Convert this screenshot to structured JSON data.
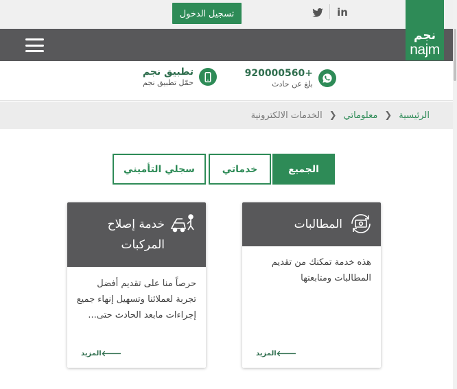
{
  "header": {
    "login_label": "تسجيل الدخول",
    "social": {
      "twitter_icon": "twitter-icon",
      "linkedin_label": "in"
    },
    "logo": {
      "arabic": "نجم",
      "latin": "najm"
    },
    "menu_icon": "hamburger-icon"
  },
  "contact": {
    "phone": {
      "number": "920000560+",
      "caption": "بلغ عن حادث",
      "icon": "whatsapp-icon"
    },
    "app": {
      "title": "تطبيق نجم",
      "caption": "حمّل تطبيق نجم",
      "icon": "mobile-phone-icon"
    }
  },
  "breadcrumb": {
    "home": "الرئيسية",
    "info": "معلوماتي",
    "current": "الخدمات الالكترونية"
  },
  "filters": {
    "all": "الجميع",
    "my_services": "خدماتي",
    "insurance_record": "سجلي التأميني",
    "active": "all"
  },
  "cards": [
    {
      "title": "المطالبات",
      "description": "هذه خدمة تمكنك من تقديم المطالبات ومتابعتها",
      "more": "المزيد",
      "icon": "claims-money-icon"
    },
    {
      "title": "خدمة إصلاح المركبات",
      "description": "حرصاً منا على تقديم أفضل تجربة لعملائنا وتسهيل إنهاء جميع إجراءات مابعد الحادث حتى...",
      "more": "المزيد",
      "icon": "car-repair-icon"
    }
  ],
  "colors": {
    "brand_green": "#2e8b57",
    "dark_gray": "#58585a"
  }
}
